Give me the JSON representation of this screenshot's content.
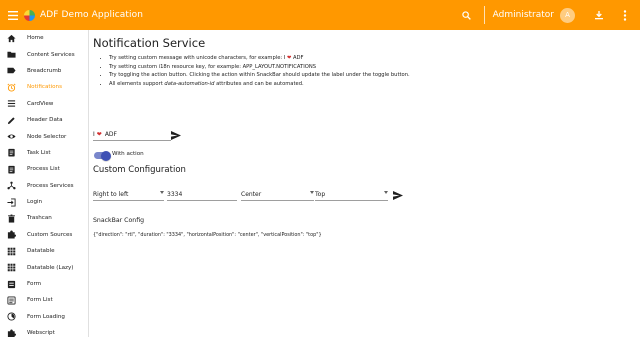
{
  "header": {
    "title": "ADF Demo Application",
    "username": "Administrator",
    "avatar_initial": "A",
    "color": "#ff9800"
  },
  "sidebar": {
    "items": [
      {
        "label": "Home",
        "icon": "home-icon"
      },
      {
        "label": "Content Services",
        "icon": "folder-icon"
      },
      {
        "label": "Breadcrumb",
        "icon": "label-icon"
      },
      {
        "label": "Notifications",
        "icon": "alarm-icon",
        "active": true
      },
      {
        "label": "CardView",
        "icon": "view-headline-icon"
      },
      {
        "label": "Header Data",
        "icon": "edit-icon"
      },
      {
        "label": "Node Selector",
        "icon": "eye-icon"
      },
      {
        "label": "Task List",
        "icon": "assignment-icon"
      },
      {
        "label": "Process List",
        "icon": "assignment-icon"
      },
      {
        "label": "Process Services",
        "icon": "device-hub-icon"
      },
      {
        "label": "Login",
        "icon": "login-icon"
      },
      {
        "label": "Trashcan",
        "icon": "delete-icon"
      },
      {
        "label": "Custom Sources",
        "icon": "extension-icon"
      },
      {
        "label": "Datatable",
        "icon": "grid-icon"
      },
      {
        "label": "Datatable (Lazy)",
        "icon": "grid-icon"
      },
      {
        "label": "Form",
        "icon": "form-icon"
      },
      {
        "label": "Form List",
        "icon": "list-icon"
      },
      {
        "label": "Form Loading",
        "icon": "timelapse-icon"
      },
      {
        "label": "Webscript",
        "icon": "extension-icon"
      }
    ]
  },
  "main": {
    "title": "Notification Service",
    "bullets": {
      "b1_prefix": "Try setting custom message with unicode characters, for example: I",
      "b1_suffix": "ADF",
      "b2": "Try setting custom i18n resource key, for example: APP_LAYOUT.NOTIFICATIONS",
      "b3": "Try toggling the action button. Clicking the action within SnackBar should update the label under the toggle button.",
      "b4_prefix": "All elements support",
      "b4_em": "data-automation-id",
      "b4_suffix": "attributes and can be automated."
    },
    "message_field": {
      "prefix": "I",
      "suffix": "ADF"
    },
    "toggle_label": "With action",
    "custom_config_title": "Custom Configuration",
    "config": {
      "direction": "Right to left",
      "duration": "3334",
      "horizontal": "Center",
      "vertical": "Top"
    },
    "snackbar_config_title": "SnackBar Config",
    "snackbar_config_json": "{\"direction\": \"rtl\", \"duration\": \"3334\", \"horizontalPosition\": \"center\", \"verticalPosition\": \"top\"}"
  }
}
